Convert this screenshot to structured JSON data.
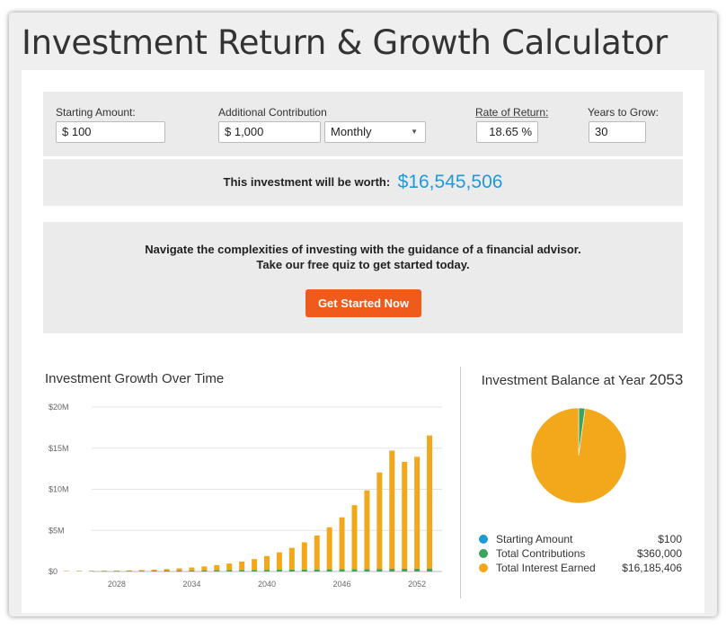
{
  "title": "Investment Return & Growth Calculator",
  "inputs": {
    "starting_amount": {
      "label": "Starting Amount:",
      "value": "$ 100"
    },
    "additional_contribution": {
      "label": "Additional Contribution",
      "value": "$ 1,000",
      "frequency": "Monthly"
    },
    "rate_of_return": {
      "label": "Rate of Return:",
      "value": "18.65",
      "unit": "%"
    },
    "years_to_grow": {
      "label": "Years to Grow:",
      "value": "30"
    }
  },
  "result": {
    "label": "This investment will be worth:",
    "value": "$16,545,506"
  },
  "promo": {
    "line1": "Navigate the complexities of investing with the guidance of a financial advisor.",
    "line2": "Take our free quiz to get started today.",
    "button": "Get Started Now"
  },
  "colors": {
    "accent": "#1f9ad7",
    "cta": "#f05a1a",
    "interest": "#f3a81c",
    "contributions": "#3aa55b",
    "starting": "#1f9ad7"
  },
  "growth_chart": {
    "title": "Investment Growth Over Time",
    "chart_data": {
      "type": "bar",
      "stacked": true,
      "x": [
        2024,
        2025,
        2026,
        2027,
        2028,
        2029,
        2030,
        2031,
        2032,
        2033,
        2034,
        2035,
        2036,
        2037,
        2038,
        2039,
        2040,
        2041,
        2042,
        2043,
        2044,
        2045,
        2046,
        2047,
        2048,
        2049,
        2050,
        2051,
        2052,
        2053
      ],
      "x_tick_labels": [
        "2028",
        "2034",
        "2040",
        "2046",
        "2052"
      ],
      "y_tick_labels": [
        "$0",
        "$5M",
        "$10M",
        "$15M",
        "$20M"
      ],
      "ylim": [
        0,
        20000000
      ],
      "grid": true,
      "series": [
        {
          "name": "Starting Amount",
          "color": "#1f9ad7",
          "values": [
            100,
            100,
            100,
            100,
            100,
            100,
            100,
            100,
            100,
            100,
            100,
            100,
            100,
            100,
            100,
            100,
            100,
            100,
            100,
            100,
            100,
            100,
            100,
            100,
            100,
            100,
            100,
            100,
            100,
            100
          ]
        },
        {
          "name": "Total Contributions",
          "color": "#3aa55b",
          "values": [
            12000,
            24000,
            36000,
            48000,
            60000,
            72000,
            84000,
            96000,
            108000,
            120000,
            132000,
            144000,
            156000,
            168000,
            180000,
            192000,
            204000,
            216000,
            228000,
            240000,
            252000,
            264000,
            276000,
            288000,
            300000,
            312000,
            324000,
            336000,
            348000,
            360000
          ]
        },
        {
          "name": "Total Interest Earned",
          "color": "#f3a81c",
          "values": [
            1200,
            5000,
            12000,
            23000,
            40000,
            63000,
            95000,
            137000,
            193000,
            264000,
            356000,
            473000,
            620000,
            805000,
            1035000,
            1320000,
            1675000,
            2110000,
            2650000,
            3310000,
            4115000,
            5100000,
            6310000,
            7780000,
            9570000,
            11740000,
            14380000,
            13000000,
            13600000,
            16185406
          ]
        }
      ]
    }
  },
  "balance": {
    "title": "Investment Balance at Year",
    "year": "2053",
    "chart_data": {
      "type": "pie",
      "slices": [
        {
          "name": "Starting Amount",
          "value": 100,
          "color": "#1f9ad7"
        },
        {
          "name": "Total Contributions",
          "value": 360000,
          "color": "#3aa55b"
        },
        {
          "name": "Total Interest Earned",
          "value": 16185406,
          "color": "#f3a81c"
        }
      ]
    },
    "legend": [
      {
        "name": "Starting Amount",
        "value": "$100",
        "color": "#1f9ad7"
      },
      {
        "name": "Total Contributions",
        "value": "$360,000",
        "color": "#3aa55b"
      },
      {
        "name": "Total Interest Earned",
        "value": "$16,185,406",
        "color": "#f3a81c"
      }
    ]
  }
}
